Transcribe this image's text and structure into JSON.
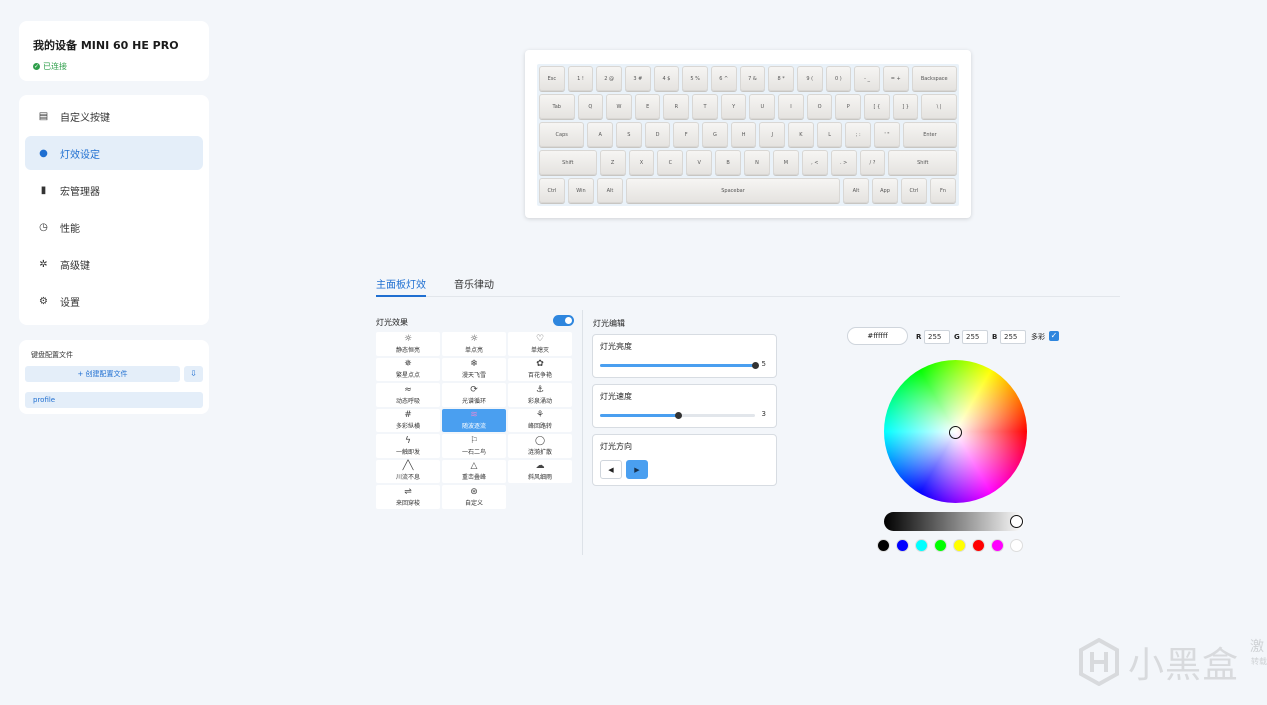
{
  "device": {
    "name": "我的设备 MINI 60 HE PRO",
    "status": "已连接"
  },
  "nav": {
    "items": [
      {
        "label": "自定义按键",
        "icon": "keymap-icon"
      },
      {
        "label": "灯效设定",
        "icon": "lightbulb-icon"
      },
      {
        "label": "宏管理器",
        "icon": "macro-icon"
      },
      {
        "label": "性能",
        "icon": "gauge-icon"
      },
      {
        "label": "高级键",
        "icon": "advanced-key-icon"
      },
      {
        "label": "设置",
        "icon": "gear-icon"
      }
    ],
    "active_index": 1
  },
  "profiles": {
    "heading": "键盘配置文件",
    "create_label": "+ 创建配置文件",
    "import_label": "⇩",
    "items": [
      "profile"
    ]
  },
  "keyboard": {
    "rows": [
      [
        "Esc",
        "1 !",
        "2 @",
        "3 #",
        "4 $",
        "5 %",
        "6 ^",
        "7 &",
        "8 *",
        "9 (",
        "0 )",
        "- _",
        "= +",
        "Backspace"
      ],
      [
        "Tab",
        "Q",
        "W",
        "E",
        "R",
        "T",
        "Y",
        "U",
        "I",
        "O",
        "P",
        "[ {",
        "] }",
        "\\ |"
      ],
      [
        "Caps",
        "A",
        "S",
        "D",
        "F",
        "G",
        "H",
        "J",
        "K",
        "L",
        "; :",
        "' \"",
        "Enter"
      ],
      [
        "Shift",
        "Z",
        "X",
        "C",
        "V",
        "B",
        "N",
        "M",
        ", <",
        ". >",
        "/ ?",
        "Shift"
      ],
      [
        "Ctrl",
        "Win",
        "Alt",
        "Spacebar",
        "Alt",
        "App",
        "Ctrl",
        "Fn"
      ]
    ]
  },
  "tabs": [
    {
      "label": "主面板灯效",
      "active": true
    },
    {
      "label": "音乐律动",
      "active": false
    }
  ],
  "effects": {
    "title": "灯光效果",
    "enabled": true,
    "items": [
      {
        "label": "静态恒亮",
        "icon": "☼"
      },
      {
        "label": "单点亮",
        "icon": "☼"
      },
      {
        "label": "单熄灭",
        "icon": "♡"
      },
      {
        "label": "繁星点点",
        "icon": "✵"
      },
      {
        "label": "漫天飞雪",
        "icon": "❄"
      },
      {
        "label": "百花争艳",
        "icon": "✿"
      },
      {
        "label": "动态呼吸",
        "icon": "≈"
      },
      {
        "label": "光谱循环",
        "icon": "⟳"
      },
      {
        "label": "彩泉涌动",
        "icon": "⚓"
      },
      {
        "label": "多彩纵横",
        "icon": "#"
      },
      {
        "label": "随波逐流",
        "icon": "≋"
      },
      {
        "label": "峰回路转",
        "icon": "⚘"
      },
      {
        "label": "一触即发",
        "icon": "ϟ"
      },
      {
        "label": "一石二鸟",
        "icon": "⚐"
      },
      {
        "label": "涟漪扩散",
        "icon": "◯"
      },
      {
        "label": "川流不息",
        "icon": "╱╲"
      },
      {
        "label": "重峦叠峰",
        "icon": "△"
      },
      {
        "label": "斜风细雨",
        "icon": "☁"
      },
      {
        "label": "来回穿梭",
        "icon": "⇌"
      },
      {
        "label": "自定义",
        "icon": "⊛"
      }
    ],
    "active_index": 10
  },
  "light_edit": {
    "title": "灯光编辑",
    "brightness": {
      "label": "灯光亮度",
      "value": 5,
      "max": 5
    },
    "speed": {
      "label": "灯光速度",
      "value": 3,
      "max": 5
    },
    "direction": {
      "label": "灯光方向",
      "left": "◀",
      "right": "▶",
      "active": "right"
    }
  },
  "color": {
    "hex": "#ffffff",
    "r_label": "R",
    "r": "255",
    "g_label": "G",
    "g": "255",
    "b_label": "B",
    "b": "255",
    "multicolor_label": "多彩",
    "multicolor_checked": true,
    "check_glyph": "✓",
    "brightness_level": 1.0,
    "swatches": [
      "#000000",
      "#0000ff",
      "#00ffff",
      "#00ff00",
      "#ffff00",
      "#ff0000",
      "#ff00ff",
      "#ffffff"
    ]
  },
  "watermark": {
    "text": "小黑盒",
    "side": "激",
    "side2": "转载"
  }
}
